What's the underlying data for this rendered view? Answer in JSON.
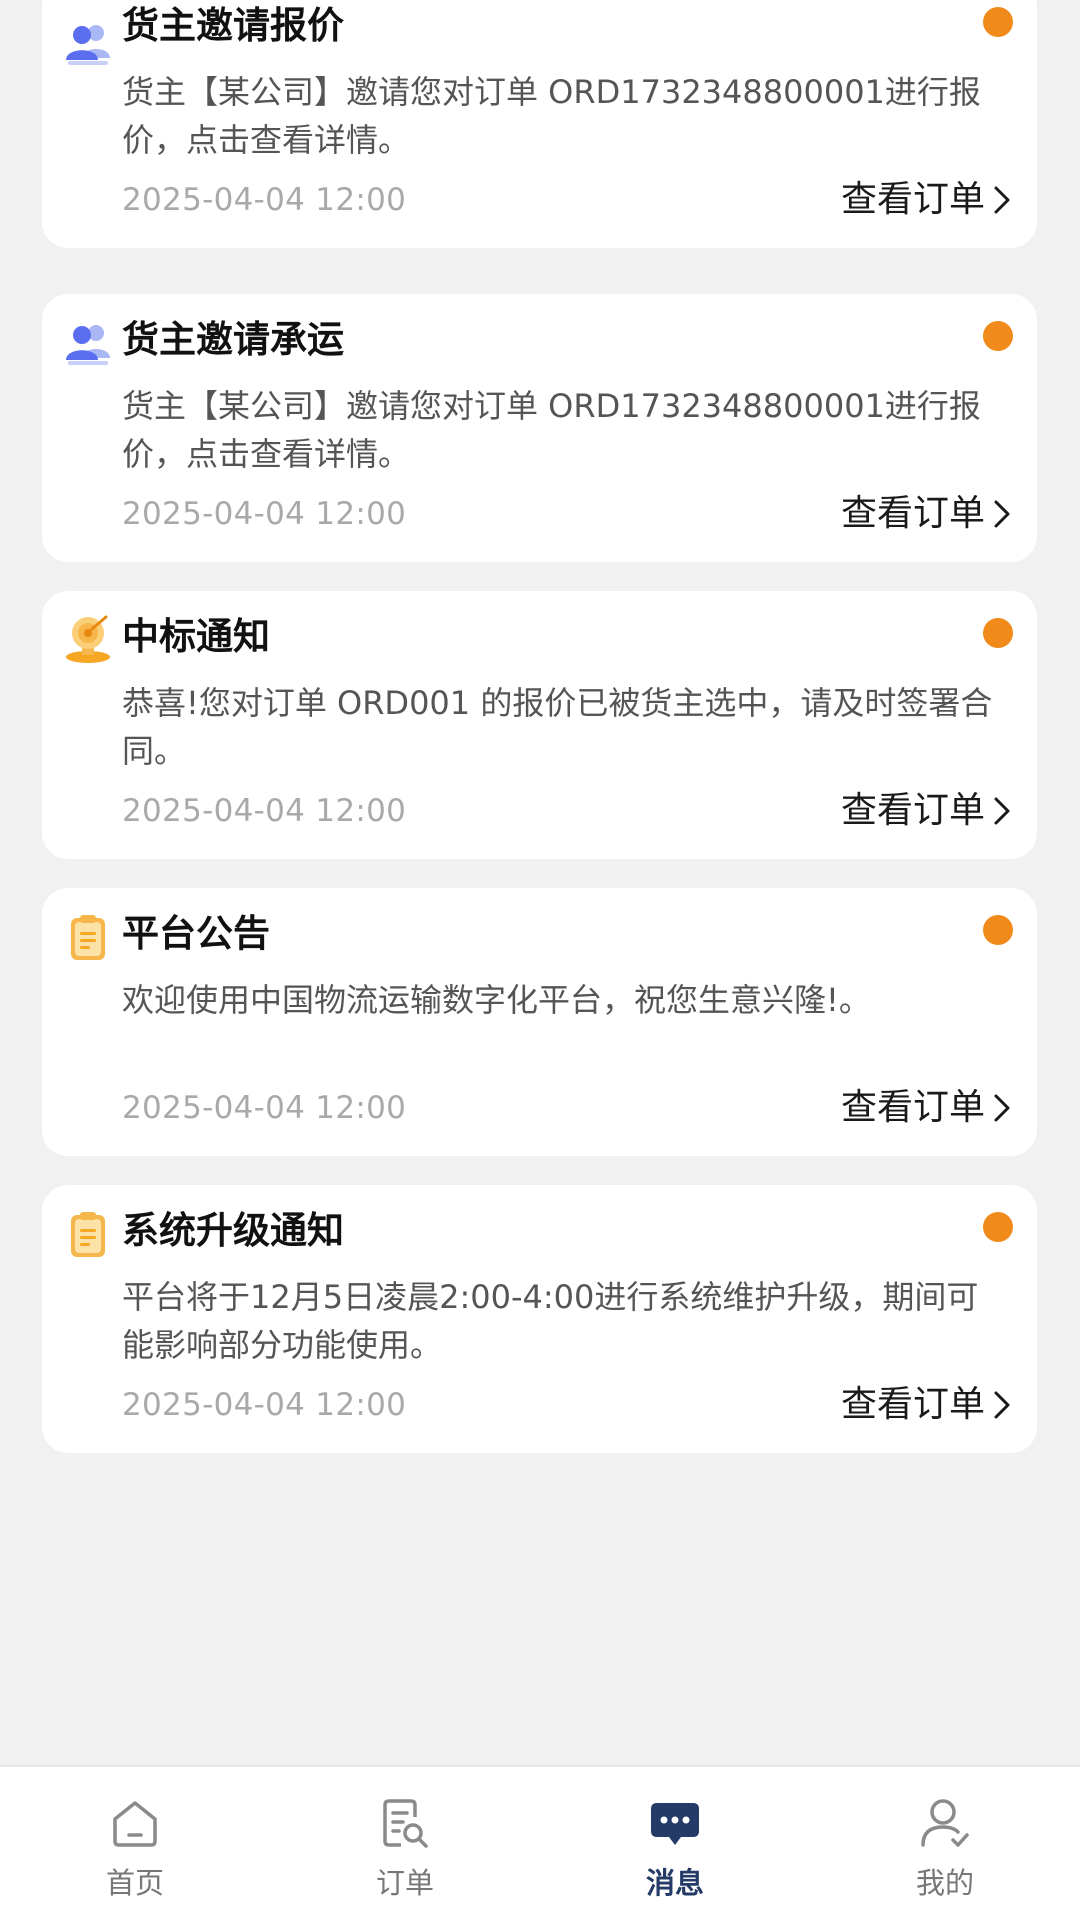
{
  "messages": [
    {
      "icon": "users-icon",
      "title": "货主邀请报价",
      "body": "货主【某公司】邀请您对订单 ORD1732348800001进行报价，点击查看详情。",
      "time": "2025-04-04 12:00",
      "action": "查看订单",
      "unread": true
    },
    {
      "icon": "users-icon",
      "title": "货主邀请承运",
      "body": "货主【某公司】邀请您对订单 ORD1732348800001进行报价，点击查看详情。",
      "time": "2025-04-04 12:00",
      "action": "查看订单",
      "unread": true
    },
    {
      "icon": "award-target-icon",
      "title": "中标通知",
      "body": "恭喜!您对订单 ORD001 的报价已被货主选中，请及时签署合同。",
      "time": "2025-04-04 12:00",
      "action": "查看订单",
      "unread": true
    },
    {
      "icon": "clipboard-icon",
      "title": "平台公告",
      "body": "欢迎使用中国物流运输数字化平台，祝您生意兴隆!。",
      "time": "2025-04-04 12:00",
      "action": "查看订单",
      "unread": true
    },
    {
      "icon": "clipboard-icon",
      "title": "系统升级通知",
      "body": "平台将于12月5日凌晨2:00-4:00进行系统维护升级，期间可能影响部分功能使用。",
      "time": "2025-04-04 12:00",
      "action": "查看订单",
      "unread": true
    }
  ],
  "tabbar": {
    "active": "消息",
    "items": [
      {
        "label": "首页",
        "icon": "home-icon"
      },
      {
        "label": "订单",
        "icon": "order-search-icon"
      },
      {
        "label": "消息",
        "icon": "chat-bubble-icon"
      },
      {
        "label": "我的",
        "icon": "user-check-icon"
      }
    ]
  },
  "colors": {
    "background": "#f1f1f1",
    "card": "#ffffff",
    "unread_dot": "#f08a1b",
    "time_text": "#a9a9a9",
    "body_text": "#555555",
    "tab_active": "#243a67",
    "tab_inactive": "#777777"
  }
}
